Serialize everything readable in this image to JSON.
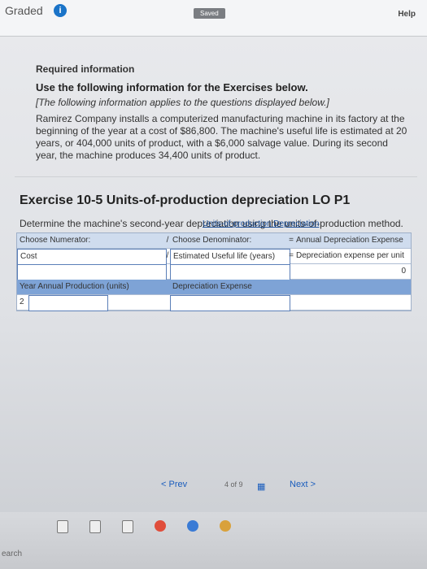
{
  "header": {
    "graded": "Graded",
    "graded_badge": "i",
    "saved": "Saved",
    "help": "Help"
  },
  "info": {
    "required": "Required information",
    "use_line": "Use the following information for the Exercises below.",
    "note": "[The following information applies to the questions displayed below.]",
    "paragraph": "Ramirez Company installs a computerized manufacturing machine in its factory at the beginning of the year at a cost of $86,800. The machine's useful life is estimated at 20 years, or 404,000 units of product, with a $6,000 salvage value. During its second year, the machine produces 34,400 units of product."
  },
  "exercise": {
    "title": "Exercise 10-5 Units-of-production depreciation LO P1",
    "instruction": "Determine the machine's second-year depreciation using the units-of-production method."
  },
  "table": {
    "caption": "Units-of-production Depreciation",
    "head": {
      "c1": "Choose Numerator:",
      "op1": "/",
      "c2": "Choose Denominator:",
      "op2": "=",
      "c3": "Annual Depreciation Expense"
    },
    "row1": {
      "c1": "Cost",
      "op1": "/",
      "c2": "Estimated Useful life (years)",
      "op2": "=",
      "c3": "Depreciation expense per unit"
    },
    "row2": {
      "end": "0"
    },
    "row3": {
      "c1": "Year  Annual Production (units)",
      "c2": "Depreciation Expense"
    },
    "row4": {
      "c1": "2"
    }
  },
  "pager": {
    "prev": "< Prev",
    "count": "4 of 9",
    "grid": "▦",
    "next": "Next >"
  },
  "taskbar": {
    "search": "earch"
  }
}
